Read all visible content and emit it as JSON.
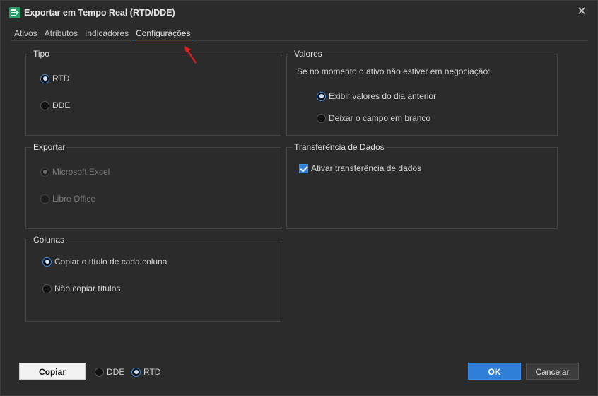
{
  "window": {
    "title": "Exportar em Tempo Real (RTD/DDE)",
    "close_symbol": "✕"
  },
  "tabs": [
    {
      "label": "Ativos",
      "active": false
    },
    {
      "label": "Atributos",
      "active": false
    },
    {
      "label": "Indicadores",
      "active": false
    },
    {
      "label": "Configurações",
      "active": true
    }
  ],
  "groups": {
    "tipo": {
      "title": "Tipo",
      "options": [
        {
          "label": "RTD",
          "checked": true
        },
        {
          "label": "DDE",
          "checked": false
        }
      ]
    },
    "valores": {
      "title": "Valores",
      "description": "Se no momento o ativo não estiver em negociação:",
      "options": [
        {
          "label": "Exibir valores do dia anterior",
          "checked": true
        },
        {
          "label": "Deixar o campo em branco",
          "checked": false
        }
      ]
    },
    "exportar": {
      "title": "Exportar",
      "options": [
        {
          "label": "Microsoft Excel",
          "checked": true,
          "disabled": true
        },
        {
          "label": "Libre Office",
          "checked": false,
          "disabled": true
        }
      ]
    },
    "transferencia": {
      "title": "Transferência de Dados",
      "checkbox_label": "Ativar transferência de dados",
      "checked": true
    },
    "colunas": {
      "title": "Colunas",
      "options": [
        {
          "label": "Copiar o título de cada coluna",
          "checked": true
        },
        {
          "label": "Não copiar títulos",
          "checked": false
        }
      ]
    }
  },
  "footer": {
    "copy_label": "Copiar",
    "format_options": [
      {
        "label": "DDE",
        "checked": false
      },
      {
        "label": "RTD",
        "checked": true
      }
    ],
    "ok_label": "OK",
    "cancel_label": "Cancelar"
  },
  "colors": {
    "accent": "#3a8ee6",
    "annotation_arrow": "#e02020"
  }
}
